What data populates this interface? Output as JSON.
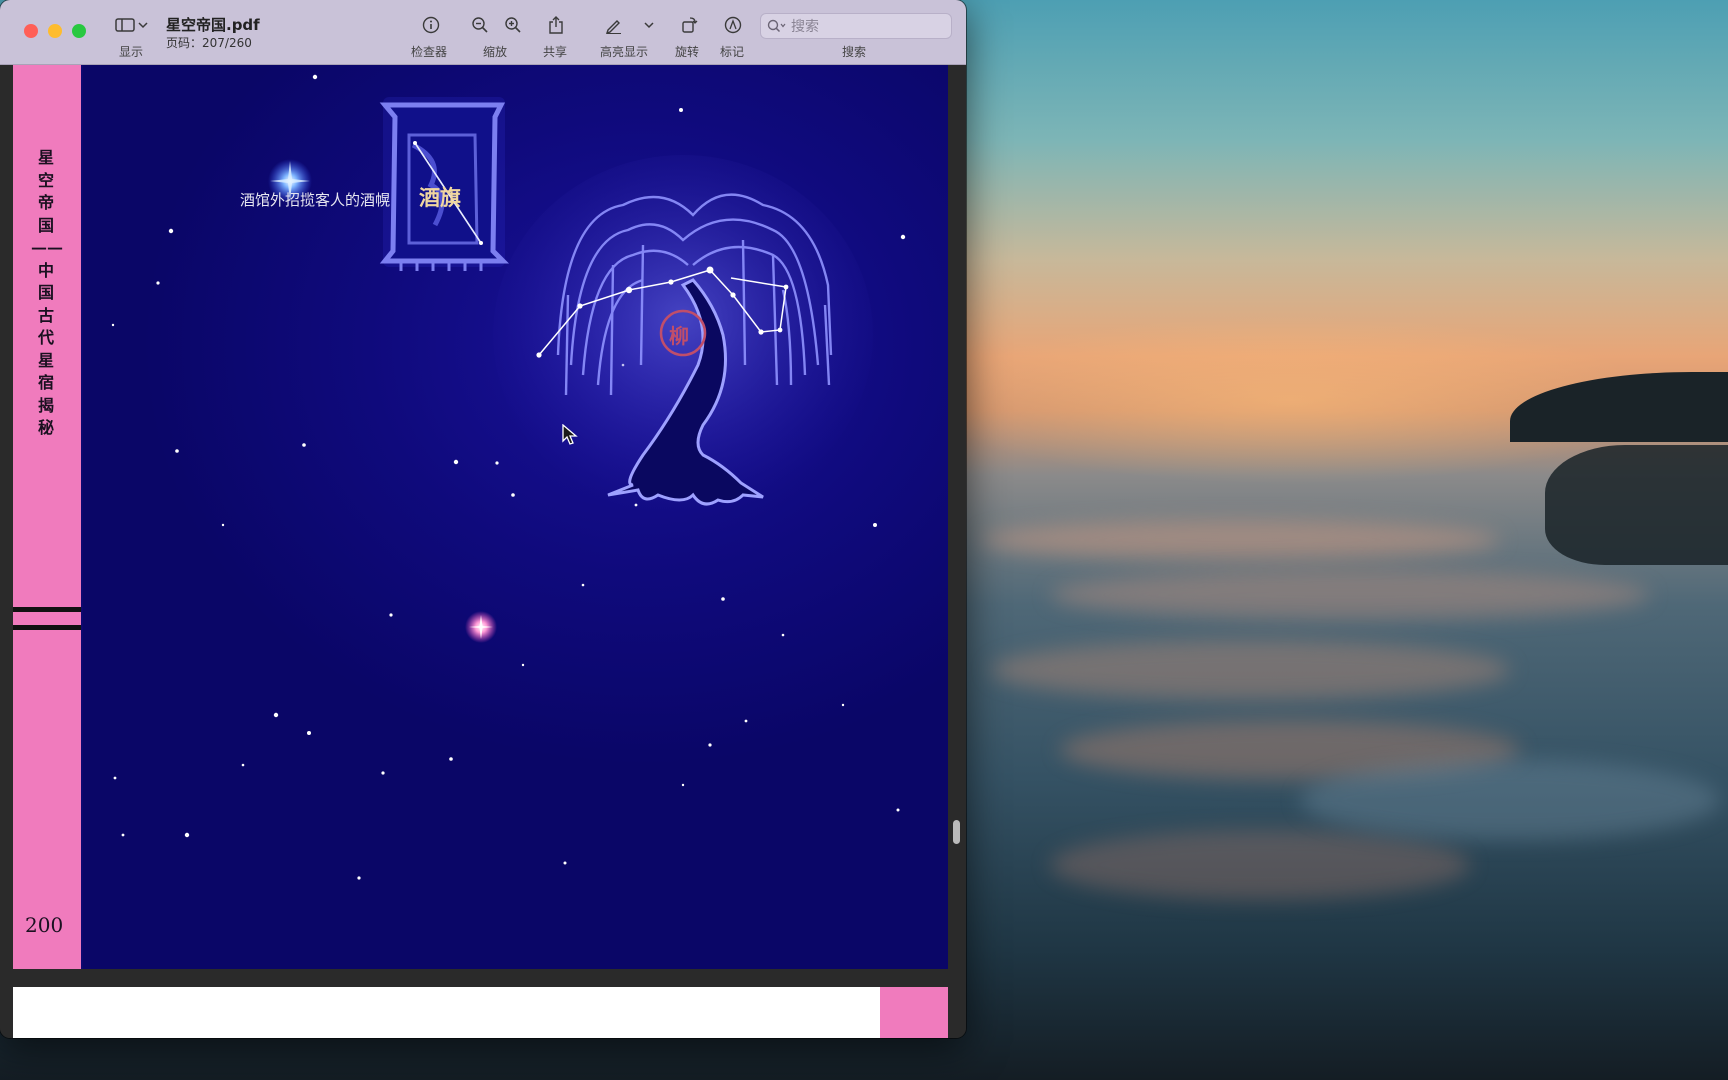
{
  "window": {
    "title": "星空帝国.pdf",
    "page_indicator": "页码：207/260"
  },
  "toolbar": {
    "view_label": "显示",
    "inspector_label": "检查器",
    "zoom_label": "缩放",
    "share_label": "共享",
    "highlight_label": "高亮显示",
    "rotate_label": "旋转",
    "markup_label": "标记",
    "search_label": "搜索",
    "search_placeholder": "搜索"
  },
  "page": {
    "spine_title": "星空帝国——中国古代星宿揭秘",
    "page_number": "200",
    "caption": "酒馆外招揽客人的酒幌",
    "banner_text": "酒旗",
    "tree_seal": "柳"
  },
  "colors": {
    "toolbar_bg": "#c9c2d8",
    "page_sky": "#0d0870",
    "spine_pink": "#f07bbd",
    "close": "#ff5f57",
    "minimize": "#febc2e",
    "zoom": "#28c840"
  },
  "icons": [
    "sidebar-icon",
    "info-icon",
    "zoom-out-icon",
    "zoom-in-icon",
    "share-icon",
    "highlight-pen-icon",
    "rotate-icon",
    "markup-icon",
    "search-icon"
  ]
}
